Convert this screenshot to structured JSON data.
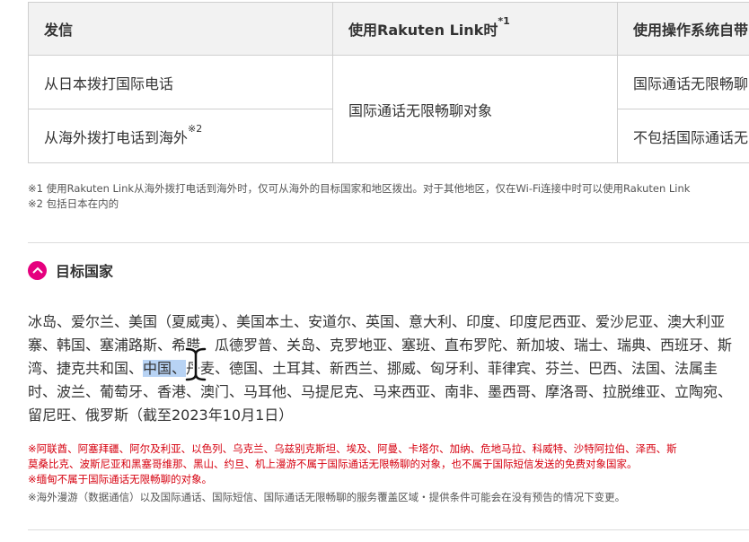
{
  "table": {
    "headers": [
      "发信",
      "使用Rakuten Link时",
      "使用操作系统自带"
    ],
    "header_sup": "*1",
    "rows": [
      {
        "label": "从日本拨打国际电话",
        "col3": "国际通话无限畅聊"
      },
      {
        "label": "从海外拨打电话到海外",
        "sup": "※2",
        "col3": "不包括国际通话无"
      }
    ],
    "merged_cell": "国际通话无限畅聊对象"
  },
  "notes": [
    "※1 使用Rakuten Link从海外拨打电话到海外时，仅可从海外的目标国家和地区拨出。对于其他地区，仅在Wi-Fi连接中时可以使用Rakuten Link",
    "※2 包括日本在内的"
  ],
  "section": {
    "title": "目标国家",
    "toggle_icon": "chevron-up-icon",
    "accent": "#e5007e"
  },
  "countries": {
    "line1": "冰岛、爱尔兰、美国（夏威夷）、美国本土、安道尔、英国、意大利、印度、印度尼西亚、爱沙尼亚、澳大利亚",
    "line2": "寨、韩国、塞浦路斯、希腊、瓜德罗普、关岛、克罗地亚、塞班、直布罗陀、新加坡、瑞士、瑞典、西班牙、斯",
    "line3_pre": "湾、捷克共和国、",
    "line3_hl": "中国、",
    "line3_post": "丹麦、德国、土耳其、新西兰、挪威、匈牙利、菲律宾、芬兰、巴西、法国、法属圭",
    "line4": "时、波兰、葡萄牙、香港、澳门、马耳他、马提尼克、马来西亚、南非、墨西哥、摩洛哥、拉脱维亚、立陶宛、",
    "line5": "留尼旺、俄罗斯（截至2023年10月1日）"
  },
  "red_notes": [
    "※阿联酋、阿塞拜疆、阿尔及利亚、以色列、乌克兰、乌兹别克斯坦、埃及、阿曼、卡塔尔、加纳、危地马拉、科威特、沙特阿拉伯、泽西、斯",
    "莫桑比克、波斯尼亚和黑塞哥维那、黑山、约旦、机上漫游不属于国际通话无限畅聊的对象，也不属于国际短信发送的免费对象国家。",
    "※缅甸不属于国际通话无限畅聊的对象。"
  ],
  "grey_note": "※海外漫游（数据通信）以及国际通话、国际短信、国际通话无限畅聊的服务覆盖区域・提供条件可能会在没有预告的情况下变更。"
}
